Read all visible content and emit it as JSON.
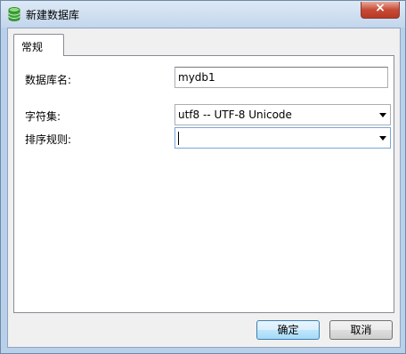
{
  "window": {
    "title": "新建数据库",
    "close_label": "×"
  },
  "tabs": [
    {
      "label": "常规",
      "active": true
    }
  ],
  "form": {
    "db_name": {
      "label": "数据库名:",
      "value": "mydb1"
    },
    "charset": {
      "label": "字符集:",
      "value": "utf8 -- UTF-8 Unicode"
    },
    "collation": {
      "label": "排序规则:",
      "value": ""
    }
  },
  "buttons": {
    "ok": "确定",
    "cancel": "取消"
  },
  "icons": {
    "app": "database-icon",
    "dropdown": "chevron-down-icon"
  },
  "colors": {
    "icon_green": "#3aa335",
    "default_button_border": "#3c7fb1"
  }
}
